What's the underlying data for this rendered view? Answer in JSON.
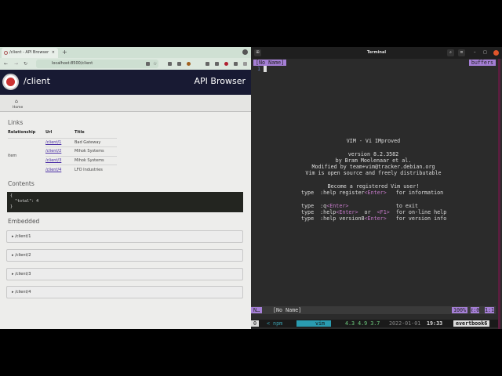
{
  "browser": {
    "tab_title": "/client - API Browser",
    "new_tab": "+",
    "close_tab": "×",
    "url": "localhost:8500/client",
    "header": {
      "title": "/client",
      "app_name": "API Browser"
    },
    "home_label": "Home",
    "links": {
      "heading": "Links",
      "columns": [
        "Relationship",
        "Url",
        "Title"
      ],
      "relationship": "item",
      "rows": [
        {
          "url": "/client/1",
          "title": "Bad Gateway"
        },
        {
          "url": "/client/2",
          "title": "Mihok Systems"
        },
        {
          "url": "/client/3",
          "title": "Mihok Systems"
        },
        {
          "url": "/client/4",
          "title": "LFO Industries"
        }
      ]
    },
    "contents": {
      "heading": "Contents",
      "json": "{\n  \"total\": 4\n}"
    },
    "embedded": {
      "heading": "Embedded",
      "items": [
        "▸ /client/1",
        "▸ /client/2",
        "▸ /client/3",
        "▸ /client/4"
      ]
    }
  },
  "terminal": {
    "title": "Terminal",
    "tab_name": "[No Name]",
    "buffers_label": "buffers",
    "line_number": "1",
    "splash": [
      "VIM - Vi IMproved",
      "",
      "version 8.2.3582",
      "by Bram Moolenaar et al.",
      "Modified by team+vim@tracker.debian.org",
      "Vim is open source and freely distributable",
      "",
      "Become a registered Vim user!"
    ],
    "help": [
      [
        "type  :help register",
        "<Enter>",
        "   for information"
      ],
      [
        "",
        "",
        " "
      ],
      [
        "type  :q",
        "<Enter>",
        "               to exit"
      ],
      [
        "type  :help",
        "<Enter>",
        "  or  <F1>  for on-line help"
      ],
      [
        "type  :help version8",
        "<Enter>",
        "   for version info"
      ]
    ],
    "statusline": {
      "mode": "N…",
      "file": "[No Name]",
      "percent": "100%",
      "pos": "ℓ:0",
      "col": "1:1"
    },
    "tmux": {
      "session": "0",
      "win1": "< npm",
      "win2": "vim",
      "load": "4.3 4.9 3.7",
      "date": "2022-01-01",
      "time": "19:33",
      "host": "evertbook6"
    }
  }
}
